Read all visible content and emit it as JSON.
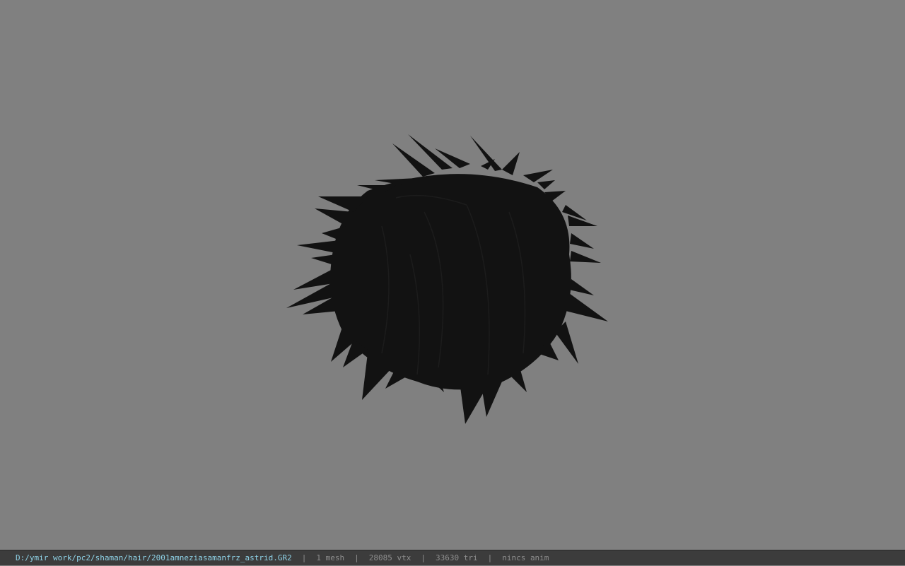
{
  "viewport": {
    "background_color": "#808080",
    "model_color": "#111111",
    "model_icon": "spiky-hair-mesh"
  },
  "status_bar": {
    "file_path": "D:/ymir work/pc2/shaman/hair/2001amneziasamanfrz_astrid.GR2",
    "separator": "|",
    "mesh_count": "1 mesh",
    "vertex_count": "28085 vtx",
    "triangle_count": "33630 tri",
    "animation": "nincs anim",
    "path_color": "#8fd3e8",
    "text_color": "#8e8e8e"
  }
}
